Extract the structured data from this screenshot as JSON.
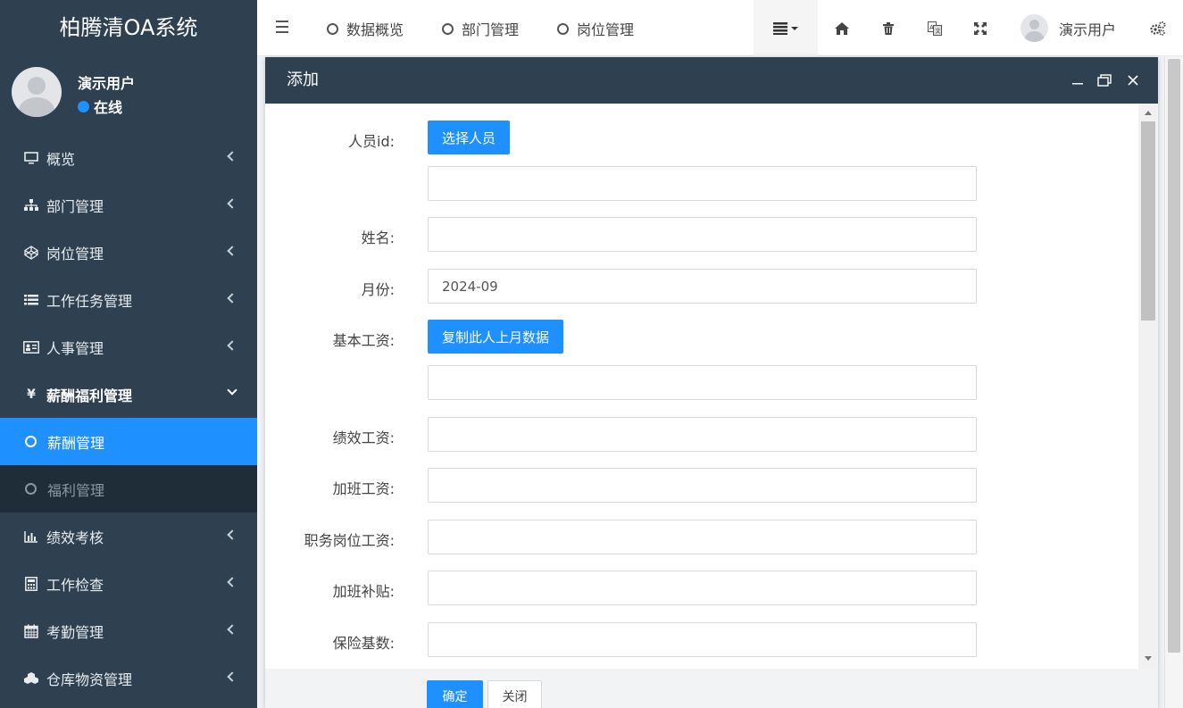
{
  "app": {
    "title": "柏腾清OA系统"
  },
  "user": {
    "name": "演示用户",
    "status": "在线"
  },
  "sidebar": {
    "items": [
      {
        "label": "概览",
        "icon": "monitor-icon"
      },
      {
        "label": "部门管理",
        "icon": "sitemap-icon"
      },
      {
        "label": "岗位管理",
        "icon": "codepen-icon"
      },
      {
        "label": "工作任务管理",
        "icon": "list-icon"
      },
      {
        "label": "人事管理",
        "icon": "id-card-icon"
      },
      {
        "label": "薪酬福利管理",
        "icon": "yen-icon"
      },
      {
        "label": "绩效考核",
        "icon": "bar-chart-icon"
      },
      {
        "label": "工作检查",
        "icon": "calculator-icon"
      },
      {
        "label": "考勤管理",
        "icon": "calendar-icon"
      },
      {
        "label": "仓库物资管理",
        "icon": "cubes-icon"
      }
    ],
    "submenu": [
      {
        "label": "薪酬管理"
      },
      {
        "label": "福利管理"
      }
    ]
  },
  "topnav": {
    "tabs": [
      {
        "label": "数据概览"
      },
      {
        "label": "部门管理"
      },
      {
        "label": "岗位管理"
      }
    ],
    "user_name": "演示用户"
  },
  "modal": {
    "title": "添加",
    "fields": {
      "person_id_label": "人员id:",
      "select_person_button": "选择人员",
      "person_id_value": "",
      "name_label": "姓名:",
      "name_value": "",
      "month_label": "月份:",
      "month_value": "2024-09",
      "base_salary_label": "基本工资:",
      "copy_last_month_button": "复制此人上月数据",
      "base_salary_value": "",
      "performance_label": "绩效工资:",
      "overtime_pay_label": "加班工资:",
      "position_pay_label": "职务岗位工资:",
      "overtime_allowance_label": "加班补贴:",
      "insurance_base_label": "保险基数:"
    },
    "confirm_button": "确定",
    "close_button": "关闭"
  },
  "colors": {
    "sidebar": "#2f4050",
    "accent": "#1e90ff",
    "submenu": "#1f2d39"
  }
}
